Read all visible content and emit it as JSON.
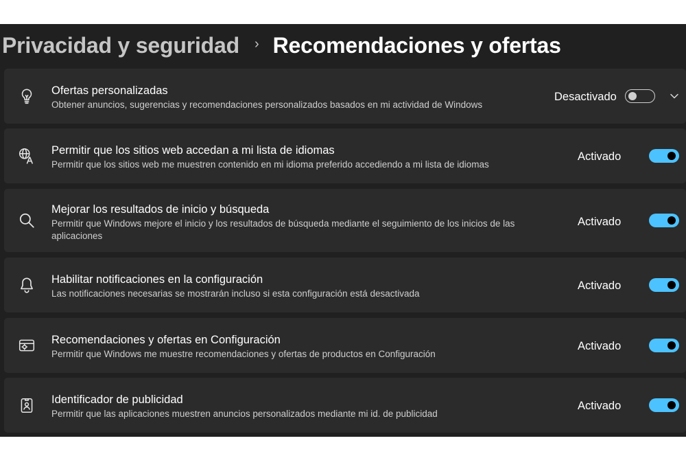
{
  "header": {
    "parent": "Privacidad y seguridad",
    "separator": "›",
    "current": "Recomendaciones y ofertas"
  },
  "colors": {
    "background": "#202020",
    "card": "#2b2b2b",
    "accent": "#4cc2ff",
    "text": "#ffffff",
    "subtext": "#cfcfcf"
  },
  "settings": [
    {
      "icon": "lightbulb-icon",
      "title": "Ofertas personalizadas",
      "description": "Obtener anuncios, sugerencias y recomendaciones personalizados basados en mi actividad de Windows",
      "status": "Desactivado",
      "enabled": false,
      "expandable": true
    },
    {
      "icon": "language-translate-icon",
      "title": "Permitir que los sitios web accedan a mi lista de idiomas",
      "description": "Permitir que los sitios web me muestren contenido en mi idioma preferido accediendo a mi lista de idiomas",
      "status": "Activado",
      "enabled": true
    },
    {
      "icon": "search-icon",
      "title": "Mejorar los resultados de inicio y búsqueda",
      "description": "Permitir que Windows mejore el inicio y los resultados de búsqueda mediante el seguimiento de los inicios de las aplicaciones",
      "status": "Activado",
      "enabled": true
    },
    {
      "icon": "bell-icon",
      "title": "Habilitar notificaciones en la configuración",
      "description": "Las notificaciones necesarias se mostrarán incluso si esta configuración está desactivada",
      "status": "Activado",
      "enabled": true
    },
    {
      "icon": "offers-icon",
      "title": "Recomendaciones y ofertas en Configuración",
      "description": "Permitir que Windows me muestre recomendaciones y ofertas de productos en Configuración",
      "status": "Activado",
      "enabled": true
    },
    {
      "icon": "advertising-id-icon",
      "title": "Identificador de publicidad",
      "description": "Permitir que las aplicaciones muestren anuncios personalizados mediante mi id. de publicidad",
      "status": "Activado",
      "enabled": true
    }
  ]
}
